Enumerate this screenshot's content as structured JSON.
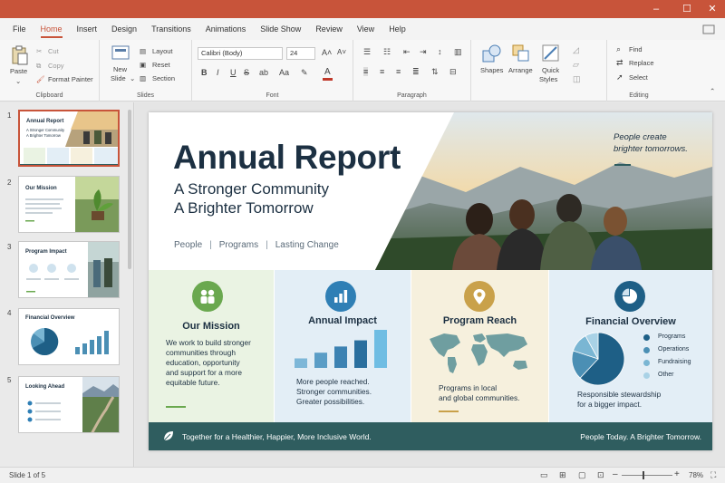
{
  "window": {
    "minimize": "–",
    "maximize": "☐",
    "close": "✕"
  },
  "menu": [
    "File",
    "Home",
    "Insert",
    "Design",
    "Transitions",
    "Animations",
    "Slide Show",
    "Review",
    "View",
    "Help"
  ],
  "ribbon": {
    "clipboard": {
      "paste": "Paste",
      "cut": "Cut",
      "copy": "Copy",
      "format_painter": "Format Painter",
      "label": "Clipboard"
    },
    "slides": {
      "new_slide_1": "New",
      "new_slide_2": "Slide",
      "layout": "Layout",
      "reset": "Reset",
      "section": "Section",
      "label": "Slides"
    },
    "font": {
      "family": "Calibri (Body)",
      "size": "24",
      "bold": "B",
      "italic": "I",
      "underline": "U",
      "strike": "S",
      "label": "Font",
      "font_color": "#c0392b",
      "highlight_color": "#ffff00"
    },
    "paragraph": {
      "label": "Paragraph"
    },
    "drawing": {
      "shapes": "Shapes",
      "arrange": "Arrange",
      "quick_styles_1": "Quick",
      "quick_styles_2": "Styles"
    },
    "editing": {
      "find": "Find",
      "replace": "Replace",
      "select": "Select",
      "label": "Editing"
    }
  },
  "thumbnails": [
    {
      "num": "1",
      "title": "Annual Report",
      "sub1": "A Stronger Community",
      "sub2": "A Brighter Tomorrow"
    },
    {
      "num": "2",
      "title": "Our Mission"
    },
    {
      "num": "3",
      "title": "Program Impact"
    },
    {
      "num": "4",
      "title": "Financial Overview"
    },
    {
      "num": "5",
      "title": "Looking Ahead"
    }
  ],
  "slide": {
    "title": "Annual Report",
    "subtitle1": "A Stronger Community",
    "subtitle2": "A Brighter Tomorrow",
    "tag1": "People",
    "tag2": "Programs",
    "tag3": "Lasting Change",
    "tag_sep": "|",
    "quote1": "People create",
    "quote2": "brighter tomorrows.",
    "cards": [
      {
        "title": "Our Mission",
        "body": [
          "We work to build stronger",
          "communities through",
          "education, opportunity",
          "and support for a more",
          "equitable future."
        ]
      },
      {
        "title": "Annual Impact",
        "body": [
          "More people reached.",
          "Stronger communities.",
          "Greater possibilities."
        ]
      },
      {
        "title": "Program Reach",
        "body": [
          "Programs in local",
          "and global communities."
        ]
      },
      {
        "title": "Financial Overview",
        "body": [
          "Responsible stewardship",
          "for a bigger impact."
        ]
      }
    ],
    "impact_chart": {
      "values": [
        20,
        32,
        45,
        58,
        80
      ],
      "colors": [
        "#7db7d8",
        "#5a9dc6",
        "#3c82b2",
        "#2a6f9e",
        "#6fbde3"
      ]
    },
    "financial_pie": [
      {
        "label": "Programs",
        "value": 62,
        "color": "#1e5f86"
      },
      {
        "label": "Operations",
        "value": 18,
        "color": "#4b8fb4"
      },
      {
        "label": "Fundraising",
        "value": 12,
        "color": "#7ab6d3"
      },
      {
        "label": "Other",
        "value": 8,
        "color": "#a9d2e6"
      }
    ],
    "footer_left": "Together for a Healthier, Happier, More Inclusive World.",
    "footer_right": "People Today. A Brighter Tomorrow."
  },
  "status": {
    "slide_counter": "Slide 1 of 5",
    "zoom": "78%",
    "minus": "–",
    "plus": "+"
  },
  "colors": {
    "accent": "#c8543a",
    "navy": "#1c3042",
    "teal_footer": "#2f5d5f",
    "mission_green": "#6aa84f",
    "reach_gold": "#c9a14a",
    "impact_blue": "#2f7fb5"
  }
}
